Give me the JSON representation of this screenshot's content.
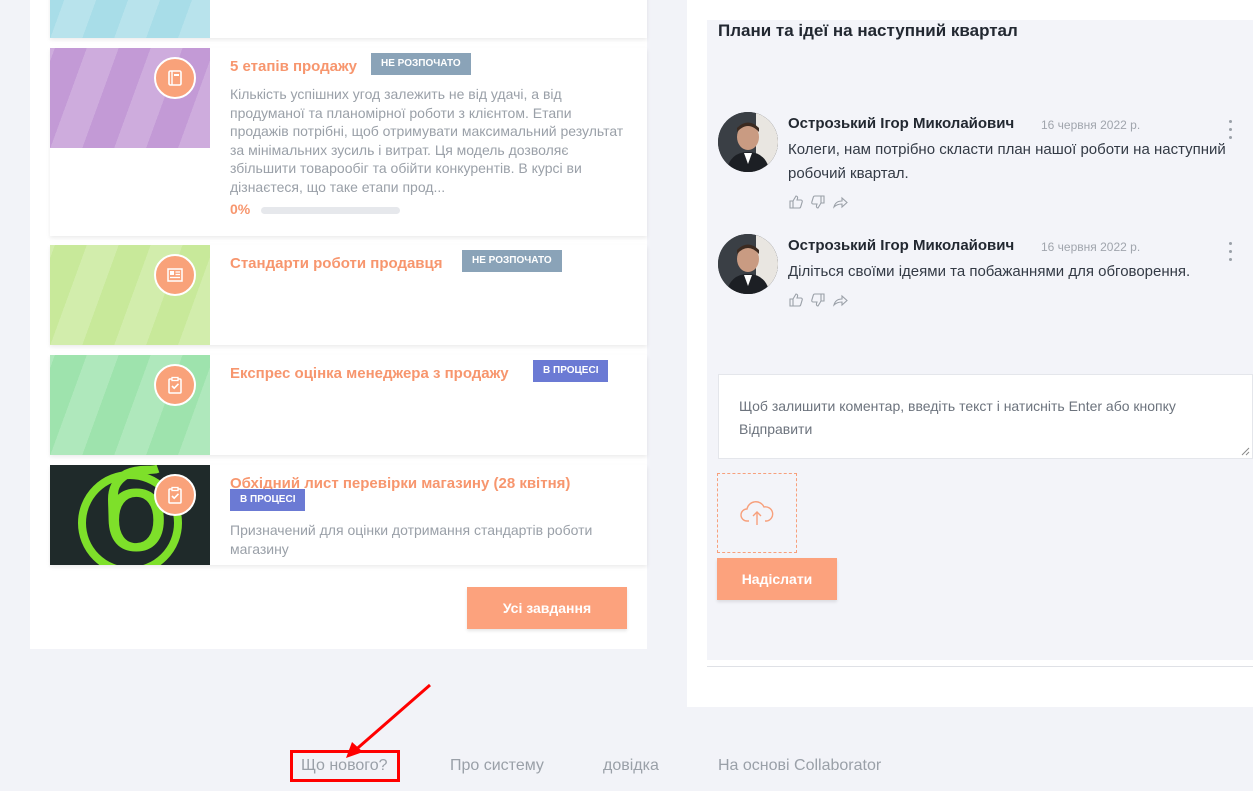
{
  "courses": [
    {
      "title": "",
      "status": "",
      "description": "",
      "thumb_color": "#a8dde8",
      "icon": "none"
    },
    {
      "title": "5 етапів продажу",
      "status": "НЕ РОЗПОЧАТО",
      "description": "Кількість успішних угод залежить не від удачі, а від продуманої та планомірної роботи з клієнтом. Етапи продажів потрібні, щоб отримувати максимальний результат за мінімальних зусиль і витрат. Ця модель дозволяє збільшити товарообіг та обійти конкурентів. В курсі ви дізнаєтеся, що таке етапи прод...",
      "progress_label": "0%",
      "progress": 0,
      "thumb_color": "#c39ad6",
      "icon": "book-icon"
    },
    {
      "title": "Стандарти роботи продавця",
      "status": "НЕ РОЗПОЧАТО",
      "description": "",
      "thumb_color": "#c8e99a",
      "icon": "document-icon"
    },
    {
      "title": "Експрес оцінка менеджера з продажу",
      "status": "В ПРОЦЕСІ",
      "description": "",
      "thumb_color": "#9ee3ad",
      "icon": "clipboard-check-icon"
    },
    {
      "title": "Обхідний лист перевірки магазину (28 квітня)",
      "status": "В ПРОЦЕСІ",
      "description": "Призначений для оцінки дотримання стандартів роботи магазину",
      "thumb_color": "#1f2a2a",
      "icon": "clipboard-check-icon",
      "logo_letter": "б"
    }
  ],
  "all_tasks_label": "Усі завдання",
  "discussion": {
    "title": "Плани та ідеї на наступний квартал",
    "comments": [
      {
        "author": "Острозький Ігор Миколайович",
        "date": "16 червня 2022 р.",
        "text": "Колеги, нам потрібно скласти план нашої роботи на наступний робочий квартал."
      },
      {
        "author": "Острозький Ігор Миколайович",
        "date": "16 червня 2022 р.",
        "text": "Діліться своїми ідеями та побажаннями для обговорення."
      }
    ],
    "input_placeholder": "Щоб залишити коментар, введіть текст і натисніть Enter або кнопку Відправити",
    "send_label": "Надіслати"
  },
  "footer": {
    "links": [
      "Що нового?",
      "Про систему",
      "довідка",
      "На основі Collaborator"
    ]
  },
  "colors": {
    "accent": "#f7966e",
    "status_gray": "#8aa3b8",
    "status_blue": "#6b7ad4",
    "annotation": "#ff0000"
  }
}
